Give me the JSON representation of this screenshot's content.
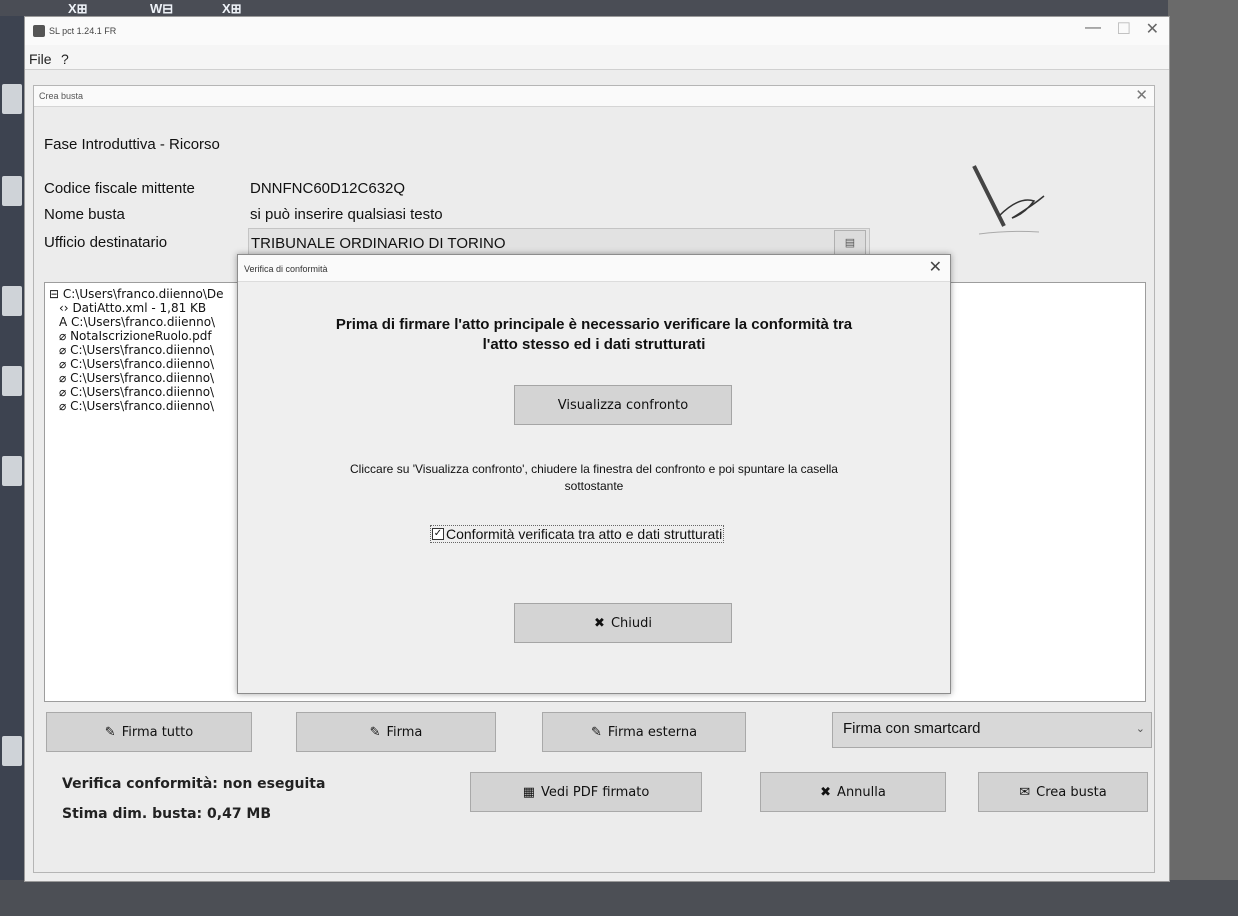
{
  "app": {
    "title": "SL pct 1.24.1 FR",
    "menu": [
      "File",
      "?"
    ]
  },
  "crea_busta": {
    "title": "Crea busta",
    "phase": "Fase Introduttiva - Ricorso",
    "fields": {
      "codice_fiscale_label": "Codice fiscale mittente",
      "codice_fiscale_value": "DNNFNC60D12C632Q",
      "nome_busta_label": "Nome busta",
      "nome_busta_value": "si può inserire qualsiasi testo",
      "ufficio_label": "Ufficio destinatario",
      "ufficio_value": "TRIBUNALE ORDINARIO DI TORINO"
    },
    "tree": [
      "C:\\Users\\franco.diienno\\De",
      "DatiAtto.xml - 1,81 KB",
      "C:\\Users\\franco.diienno\\",
      "NotaIscrizioneRuolo.pdf",
      "C:\\Users\\franco.diienno\\",
      "C:\\Users\\franco.diienno\\",
      "C:\\Users\\franco.diienno\\",
      "C:\\Users\\franco.diienno\\",
      "C:\\Users\\franco.diienno\\"
    ],
    "buttons": {
      "firma_tutto": "Firma tutto",
      "firma": "Firma",
      "firma_esterna": "Firma esterna",
      "firma_mode": "Firma con smartcard",
      "vedi_pdf": "Vedi PDF firmato",
      "annulla": "Annulla",
      "crea_busta": "Crea busta"
    },
    "status": {
      "verifica": "Verifica conformità: non eseguita",
      "stima": "Stima dim. busta: 0,47 MB"
    }
  },
  "dialog": {
    "title": "Verifica di conformità",
    "heading_line1": "Prima di firmare l'atto principale è necessario verificare la conformità tra",
    "heading_line2": "l'atto stesso ed i dati strutturati",
    "visualizza_button": "Visualizza confronto",
    "info_line1": "Cliccare su 'Visualizza confronto', chiudere la finestra del confronto e poi spuntare la casella",
    "info_line2": "sottostante",
    "checkbox_label": "Conformità verificata tra atto e dati strutturati",
    "checkbox_checked": true,
    "chiudi_button": "Chiudi"
  }
}
